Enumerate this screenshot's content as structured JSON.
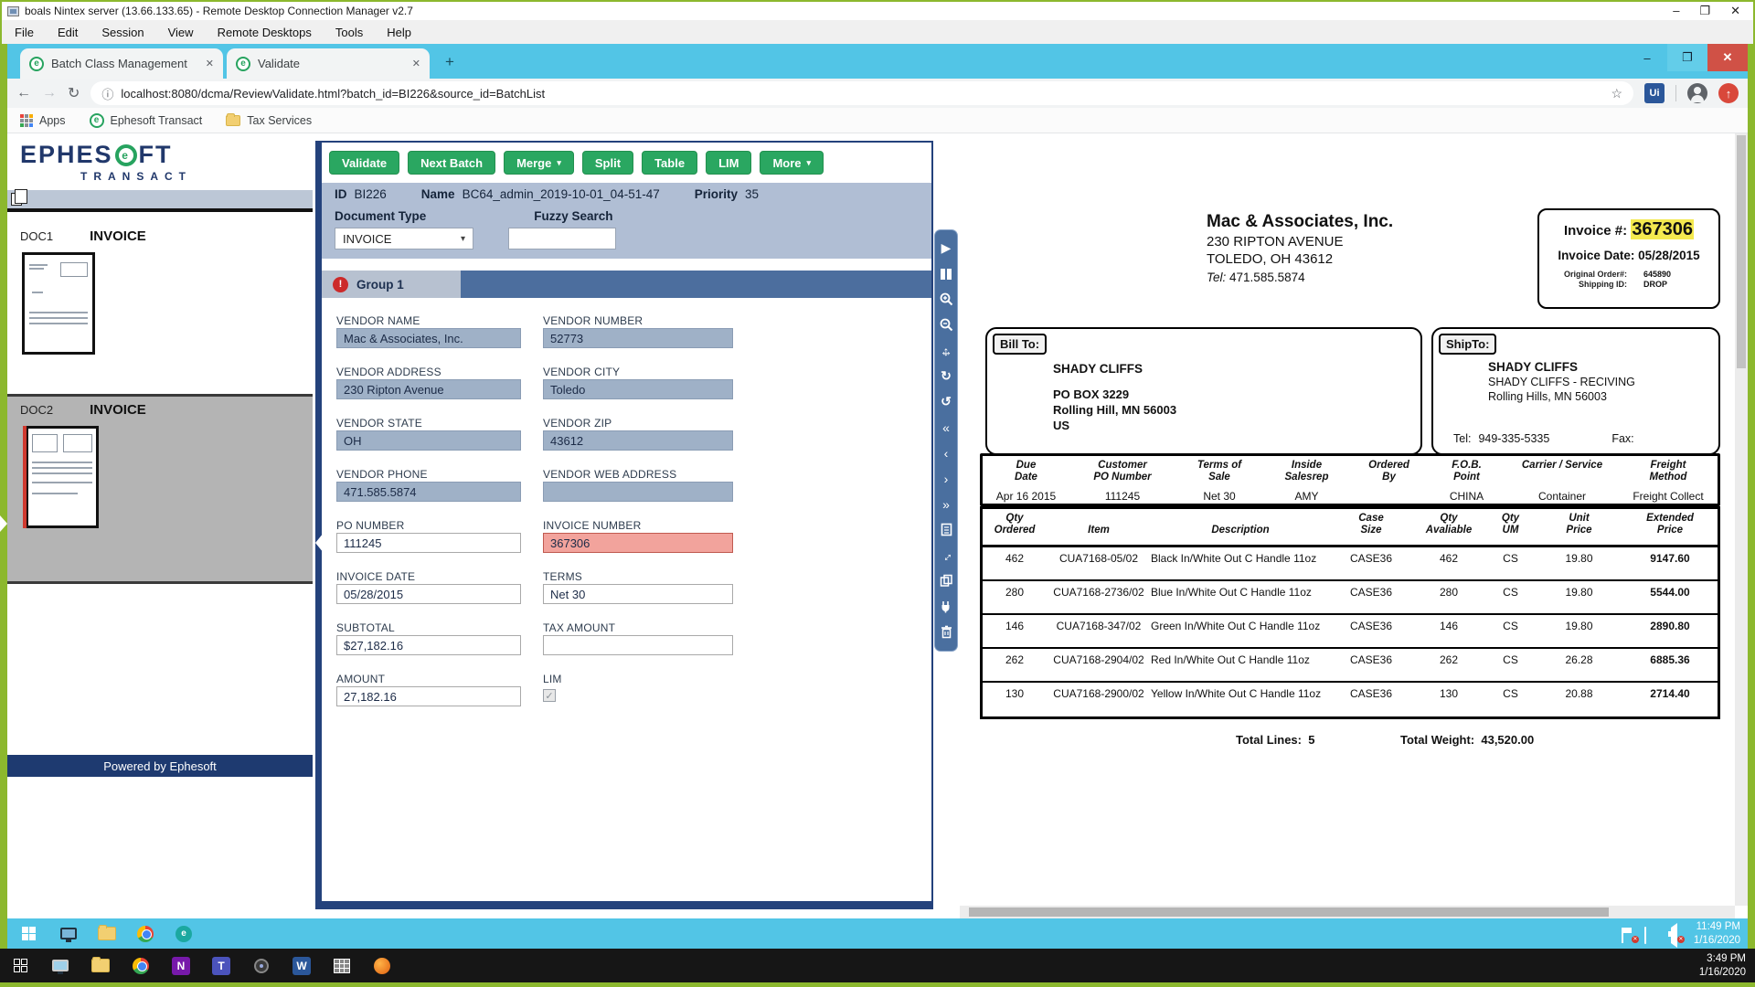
{
  "rdcman": {
    "title": "boals Nintex server (13.66.133.65) - Remote Desktop Connection Manager v2.7",
    "menus": [
      "File",
      "Edit",
      "Session",
      "View",
      "Remote Desktops",
      "Tools",
      "Help"
    ]
  },
  "browser": {
    "tabs": [
      {
        "label": "Batch Class Management"
      },
      {
        "label": "Validate"
      }
    ],
    "url": "localhost:8080/dcma/ReviewValidate.html?batch_id=BI226&source_id=BatchList",
    "bookmarks": {
      "apps": "Apps",
      "ephesoft": "Ephesoft Transact",
      "tax": "Tax Services"
    },
    "extension_badge": "Ui"
  },
  "icons": {
    "minimize": "–",
    "restore": "❐",
    "close_x": "✕",
    "plus": "+",
    "back": "←",
    "forward": "→",
    "reload": "↻",
    "info": "ⓘ",
    "star": "☆",
    "caret_down": "▾",
    "alert": "!",
    "check": "✓",
    "update_arrow": "↑",
    "play": "▶",
    "rotate_cw": "↻",
    "rotate_ccw": "↺",
    "chevron_double_left": "«",
    "chevron_left": "‹",
    "chevron_right": "›",
    "chevron_double_right": "»",
    "arrow_lr": "↔",
    "arrow_ud": "↕",
    "fav_letter": "e",
    "teal_letter": "e",
    "onenote_letter": "N",
    "word_letter": "W",
    "teams_letter": "T"
  },
  "sidebar": {
    "logo_main": "EPHES",
    "logo_o": "e",
    "logo_tail": "FT",
    "logo_sub": "TRANSACT",
    "docs": [
      {
        "id": "DOC1",
        "type": "INVOICE"
      },
      {
        "id": "DOC2",
        "type": "INVOICE"
      }
    ],
    "footer": "Powered by Ephesoft"
  },
  "toolbar": {
    "validate": "Validate",
    "next_batch": "Next Batch",
    "merge": "Merge",
    "split": "Split",
    "table": "Table",
    "lim": "LIM",
    "more": "More"
  },
  "batch": {
    "id_label": "ID",
    "id": "BI226",
    "name_label": "Name",
    "name": "BC64_admin_2019-10-01_04-51-47",
    "priority_label": "Priority",
    "priority": "35",
    "doc_type_label": "Document Type",
    "doc_type_value": "INVOICE",
    "fuzzy_label": "Fuzzy Search",
    "fuzzy_value": ""
  },
  "group": {
    "tab": "Group 1"
  },
  "fields": {
    "left": [
      {
        "label": "VENDOR NAME",
        "value": "Mac & Associates, Inc.",
        "style": "filled"
      },
      {
        "label": "VENDOR ADDRESS",
        "value": "230 Ripton Avenue",
        "style": "filled"
      },
      {
        "label": "VENDOR STATE",
        "value": "OH",
        "style": "filled"
      },
      {
        "label": "VENDOR PHONE",
        "value": "471.585.5874",
        "style": "filled"
      },
      {
        "label": "PO NUMBER",
        "value": "111245",
        "style": "white",
        "active": true
      },
      {
        "label": "INVOICE DATE",
        "value": "05/28/2015",
        "style": "white"
      },
      {
        "label": "SUBTOTAL",
        "value": "$27,182.16",
        "style": "white"
      },
      {
        "label": "AMOUNT",
        "value": "27,182.16",
        "style": "white"
      }
    ],
    "right": [
      {
        "label": "VENDOR NUMBER",
        "value": "52773",
        "style": "filled"
      },
      {
        "label": "VENDOR CITY",
        "value": "Toledo",
        "style": "filled"
      },
      {
        "label": "VENDOR ZIP",
        "value": "43612",
        "style": "filled"
      },
      {
        "label": "VENDOR WEB ADDRESS",
        "value": "",
        "style": "filled"
      },
      {
        "label": "INVOICE NUMBER",
        "value": "367306",
        "style": "error"
      },
      {
        "label": "TERMS",
        "value": "Net 30",
        "style": "white"
      },
      {
        "label": "TAX AMOUNT",
        "value": "",
        "style": "white"
      },
      {
        "label": "LIM",
        "checkbox": true,
        "checked": true
      }
    ]
  },
  "invoice_doc": {
    "vendor_name": "Mac & Associates, Inc.",
    "vendor_address": "230 RIPTON AVENUE",
    "vendor_city": "TOLEDO, OH  43612",
    "vendor_tel_label": "Tel:",
    "vendor_tel": "471.585.5874",
    "invoice_no_label": "Invoice #:",
    "invoice_no": "367306",
    "invoice_date_label": "Invoice Date:",
    "invoice_date": "05/28/2015",
    "original_order_label": "Original Order#:",
    "original_order": "645890",
    "shipping_id_label": "Shipping ID:",
    "shipping_id": "DROP",
    "bill_to_label": "Bill To:",
    "bill_to_name": "SHADY CLIFFS",
    "bill_to_line1": "PO BOX 3229",
    "bill_to_line2": "Rolling Hill, MN  56003",
    "bill_to_line3": "US",
    "ship_to_label": "ShipTo:",
    "ship_to_name": "SHADY CLIFFS",
    "ship_to_line1": "SHADY CLIFFS - RECIVING",
    "ship_to_line2": "Rolling Hills, MN 56003",
    "ship_tel_label": "Tel:",
    "ship_tel": "949-335-5335",
    "ship_fax_label": "Fax:",
    "info": {
      "headers": [
        [
          "Due",
          "Date"
        ],
        [
          "Customer",
          "PO Number"
        ],
        [
          "Terms of",
          "Sale"
        ],
        [
          "Inside",
          "Salesrep"
        ],
        [
          "Ordered",
          "By"
        ],
        [
          "F.O.B.",
          "Point"
        ],
        [
          "Carrier / Service",
          ""
        ],
        [
          "Freight",
          "Method"
        ]
      ],
      "values": [
        "Apr 16 2015",
        "111245",
        "Net 30",
        "AMY",
        "",
        "CHINA",
        "Container",
        "Freight Collect"
      ]
    },
    "items_headers": [
      [
        "Qty",
        "Ordered"
      ],
      [
        "Item",
        ""
      ],
      [
        "Description",
        ""
      ],
      [
        "Case",
        "Size"
      ],
      [
        "Qty",
        "Avaliable"
      ],
      [
        "Qty",
        "UM"
      ],
      [
        "Unit",
        "Price"
      ],
      [
        "Extended",
        "Price"
      ]
    ],
    "items": [
      {
        "qty": "462",
        "item": "CUA7168-05/02",
        "desc": "Black In/White Out C Handle 11oz",
        "case": "CASE36",
        "avail": "462",
        "um": "CS",
        "unit": "19.80",
        "ext": "9147.60"
      },
      {
        "qty": "280",
        "item": "CUA7168-2736/02",
        "desc": "Blue In/White Out C Handle 11oz",
        "case": "CASE36",
        "avail": "280",
        "um": "CS",
        "unit": "19.80",
        "ext": "5544.00"
      },
      {
        "qty": "146",
        "item": "CUA7168-347/02",
        "desc": "Green In/White Out C Handle 11oz",
        "case": "CASE36",
        "avail": "146",
        "um": "CS",
        "unit": "19.80",
        "ext": "2890.80"
      },
      {
        "qty": "262",
        "item": "CUA7168-2904/02",
        "desc": "Red In/White Out C Handle 11oz",
        "case": "CASE36",
        "avail": "262",
        "um": "CS",
        "unit": "26.28",
        "ext": "6885.36"
      },
      {
        "qty": "130",
        "item": "CUA7168-2900/02",
        "desc": "Yellow In/White Out C Handle 11oz",
        "case": "CASE36",
        "avail": "130",
        "um": "CS",
        "unit": "20.88",
        "ext": "2714.40"
      }
    ],
    "total_lines_label": "Total Lines:",
    "total_lines": "5",
    "total_weight_label": "Total Weight:",
    "total_weight": "43,520.00"
  },
  "taskbar_remote": {
    "time": "11:49 PM",
    "date": "1/16/2020"
  },
  "taskbar_host": {
    "time": "3:49 PM",
    "date": "1/16/2020"
  },
  "colors": {
    "rdc_green": "#8cb82e",
    "chrome_cyan": "#52c5e6",
    "button_green": "#2aa761",
    "panel_border_blue": "#24427c",
    "rail_blue": "#4a6f9f",
    "meta_blue": "#b0bed4",
    "field_fill": "#9fb1c7",
    "field_error_bg": "#f2a39c",
    "alert_red": "#cc2a2a",
    "highlight_yellow": "#f4e94f",
    "powered_navy": "#1e3a70"
  }
}
